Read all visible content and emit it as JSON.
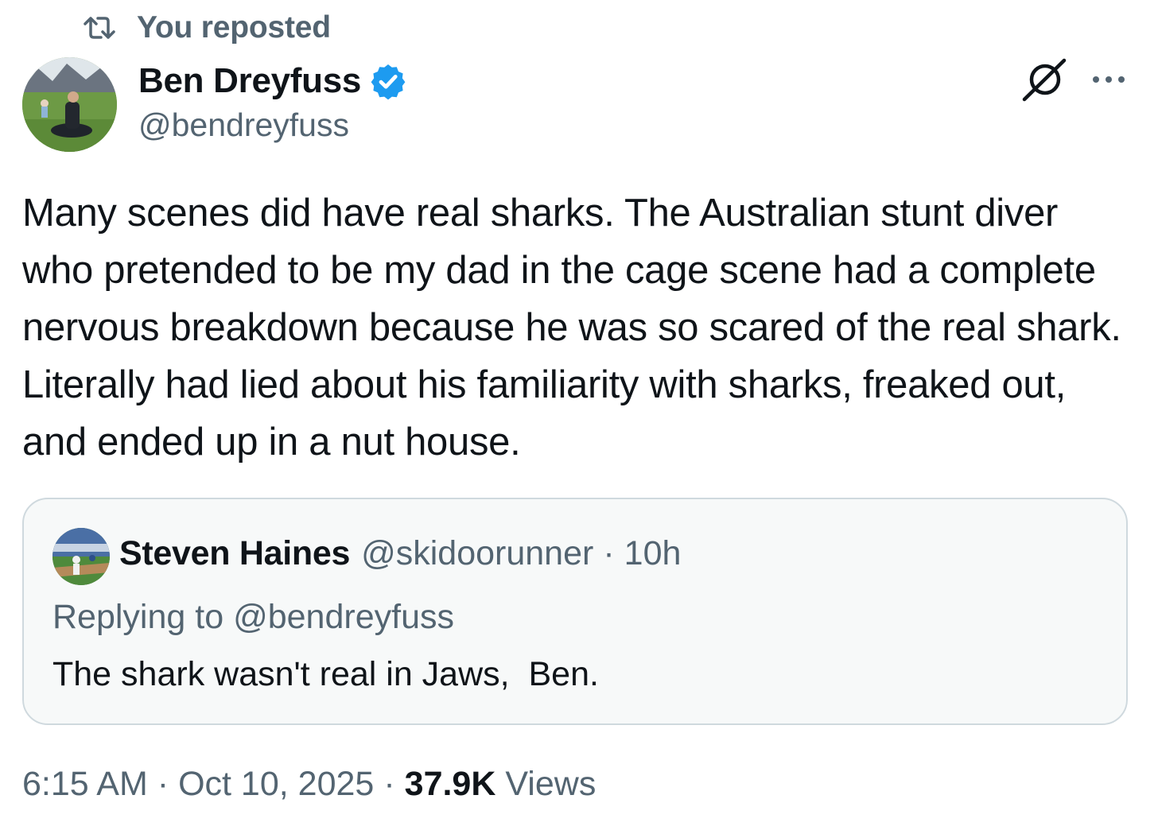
{
  "repost_banner": {
    "icon": "repost-icon",
    "text": "You reposted"
  },
  "author": {
    "display_name": "Ben Dreyfuss",
    "handle": "@bendreyfuss",
    "verified": true,
    "avatar": "avatar-photo"
  },
  "header_actions": {
    "grok_icon": "grok-icon",
    "more_icon": "more-icon"
  },
  "tweet": {
    "text": "Many scenes did have real sharks. The Australian stunt diver who pretended to be my dad in the cage scene had a complete nervous breakdown because he was so scared of the real shark. Literally had lied about his familiarity with sharks, freaked out, and ended up in a nut house."
  },
  "quoted_tweet": {
    "display_name": "Steven Haines",
    "handle": "@skidoorunner",
    "separator": "·",
    "time": "10h",
    "replying_to": "Replying to @bendreyfuss",
    "text": "The shark wasn't real in Jaws,  Ben."
  },
  "meta": {
    "time": "6:15 AM",
    "separator": "·",
    "date": "Oct 10, 2025",
    "views_count": "37.9K",
    "views_label": "Views"
  },
  "colors": {
    "text_primary": "#0f1419",
    "text_secondary": "#536471",
    "verified_blue": "#1d9bf0",
    "card_border": "#cfd9de",
    "card_bg": "#f7f9f9"
  }
}
